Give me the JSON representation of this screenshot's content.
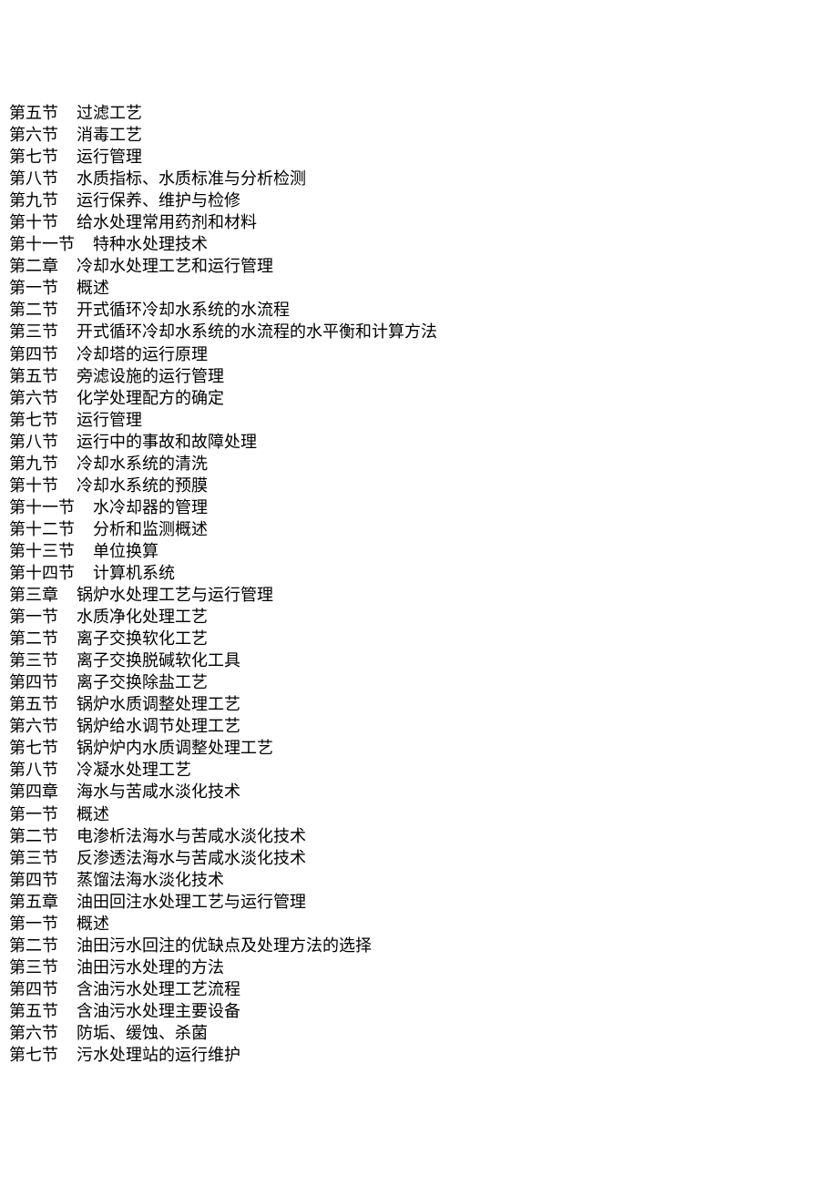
{
  "document": {
    "toc": [
      {
        "label": "第五节",
        "title": "过滤工艺",
        "level": "section"
      },
      {
        "label": "第六节",
        "title": "消毒工艺",
        "level": "section"
      },
      {
        "label": "第七节",
        "title": "运行管理",
        "level": "section"
      },
      {
        "label": "第八节",
        "title": "水质指标、水质标准与分析检测",
        "level": "section"
      },
      {
        "label": "第九节",
        "title": "运行保养、维护与检修",
        "level": "section"
      },
      {
        "label": "第十节",
        "title": "给水处理常用药剂和材料",
        "level": "section"
      },
      {
        "label": "第十一节",
        "title": "特种水处理技术",
        "level": "section"
      },
      {
        "label": "第二章",
        "title": "冷却水处理工艺和运行管理",
        "level": "chapter"
      },
      {
        "label": "第一节",
        "title": "概述",
        "level": "section"
      },
      {
        "label": "第二节",
        "title": "开式循环冷却水系统的水流程",
        "level": "section"
      },
      {
        "label": "第三节",
        "title": "开式循环冷却水系统的水流程的水平衡和计算方法",
        "level": "section"
      },
      {
        "label": "第四节",
        "title": "冷却塔的运行原理",
        "level": "section"
      },
      {
        "label": "第五节",
        "title": "旁滤设施的运行管理",
        "level": "section"
      },
      {
        "label": "第六节",
        "title": "化学处理配方的确定",
        "level": "section"
      },
      {
        "label": "第七节",
        "title": "运行管理",
        "level": "section"
      },
      {
        "label": "第八节",
        "title": "运行中的事故和故障处理",
        "level": "section"
      },
      {
        "label": "第九节",
        "title": "冷却水系统的清洗",
        "level": "section"
      },
      {
        "label": "第十节",
        "title": "冷却水系统的预膜",
        "level": "section"
      },
      {
        "label": "第十一节",
        "title": "水冷却器的管理",
        "level": "section"
      },
      {
        "label": "第十二节",
        "title": "分析和监测概述",
        "level": "section"
      },
      {
        "label": "第十三节",
        "title": "单位换算",
        "level": "section"
      },
      {
        "label": "第十四节",
        "title": "计算机系统",
        "level": "section"
      },
      {
        "label": "第三章",
        "title": "锅炉水处理工艺与运行管理",
        "level": "chapter"
      },
      {
        "label": "第一节",
        "title": "水质净化处理工艺",
        "level": "section"
      },
      {
        "label": "第二节",
        "title": "离子交换软化工艺",
        "level": "section"
      },
      {
        "label": "第三节",
        "title": "离子交换脱碱软化工具",
        "level": "section"
      },
      {
        "label": "第四节",
        "title": "离子交换除盐工艺",
        "level": "section"
      },
      {
        "label": "第五节",
        "title": "锅炉水质调整处理工艺",
        "level": "section"
      },
      {
        "label": "第六节",
        "title": "锅炉给水调节处理工艺",
        "level": "section"
      },
      {
        "label": "第七节",
        "title": "锅炉炉内水质调整处理工艺",
        "level": "section"
      },
      {
        "label": "第八节",
        "title": "冷凝水处理工艺",
        "level": "section"
      },
      {
        "label": "第四章",
        "title": "海水与苦咸水淡化技术",
        "level": "chapter"
      },
      {
        "label": "第一节",
        "title": "概述",
        "level": "section"
      },
      {
        "label": "第二节",
        "title": "电渗析法海水与苦咸水淡化技术",
        "level": "section"
      },
      {
        "label": "第三节",
        "title": "反渗透法海水与苦咸水淡化技术",
        "level": "section"
      },
      {
        "label": "第四节",
        "title": "蒸馏法海水淡化技术",
        "level": "section"
      },
      {
        "label": "第五章",
        "title": "油田回注水处理工艺与运行管理",
        "level": "chapter"
      },
      {
        "label": "第一节",
        "title": "概述",
        "level": "section"
      },
      {
        "label": "第二节",
        "title": "油田污水回注的优缺点及处理方法的选择",
        "level": "section"
      },
      {
        "label": "第三节",
        "title": "油田污水处理的方法",
        "level": "section"
      },
      {
        "label": "第四节",
        "title": "含油污水处理工艺流程",
        "level": "section"
      },
      {
        "label": "第五节",
        "title": "含油污水处理主要设备",
        "level": "section"
      },
      {
        "label": "第六节",
        "title": "防垢、缓蚀、杀菌",
        "level": "section"
      },
      {
        "label": "第七节",
        "title": "污水处理站的运行维护",
        "level": "section"
      }
    ]
  }
}
